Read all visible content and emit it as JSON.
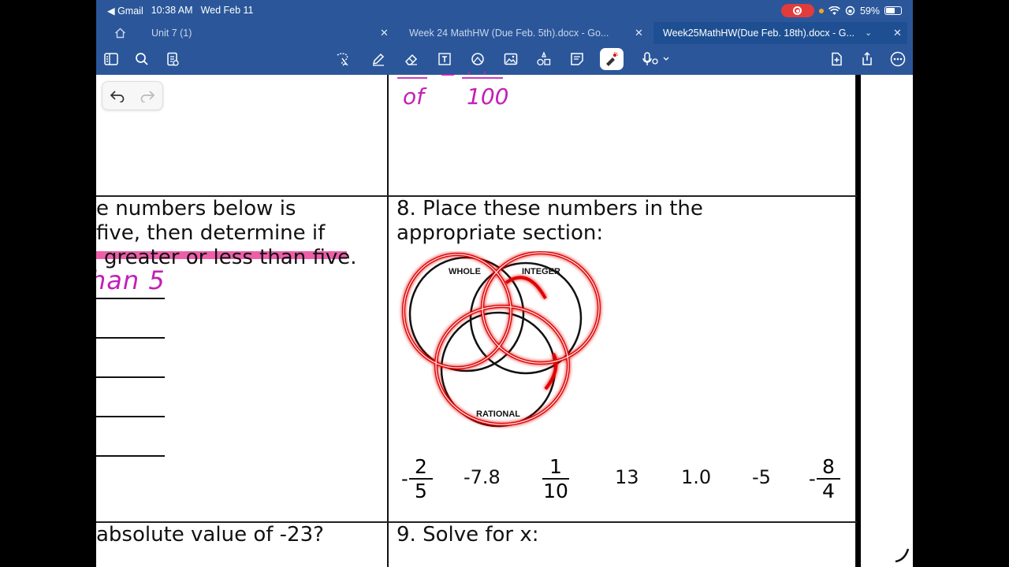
{
  "status": {
    "app_back": "◀ Gmail",
    "time": "10:38 AM",
    "date": "Wed Feb 11",
    "battery": "59%",
    "battery_level": 0.59
  },
  "tabs": [
    {
      "label": "Unit 7 (1)"
    },
    {
      "label": "Week 24 MathHW (Due Feb. 5th).docx - Go..."
    },
    {
      "label": "Week25MathHW(Due Feb. 18th).docx - G..."
    }
  ],
  "toolbar": {
    "left_icons": [
      "sidebar-icon",
      "search-icon",
      "document-view-icon"
    ],
    "center_icons": [
      "lasso-icon",
      "pen-icon",
      "eraser-icon",
      "text-box-icon",
      "shapes-icon",
      "image-icon",
      "stickers-icon",
      "sticky-note-icon",
      "laser-pointer-icon",
      "microphone-icon"
    ],
    "right_icons": [
      "add-page-icon",
      "share-icon",
      "more-icon"
    ]
  },
  "document": {
    "handwriting_top": {
      "numerator_left": "of",
      "denominator": "100"
    },
    "q7": {
      "lines": [
        "e numbers below is",
        "five, then determine if",
        "greater or less than five."
      ],
      "handwriting": "han 5"
    },
    "q8": {
      "lines": [
        "8. Place these numbers in the",
        "appropriate section:"
      ],
      "venn_labels": {
        "whole": "WHOLE",
        "integer": "INTEGER",
        "rational": "RATIONAL"
      },
      "numbers": [
        {
          "type": "fraction",
          "sign": "-",
          "num": "2",
          "den": "5"
        },
        {
          "type": "text",
          "value": "-7.8"
        },
        {
          "type": "fraction",
          "sign": "",
          "num": "1",
          "den": "10"
        },
        {
          "type": "text",
          "value": "13"
        },
        {
          "type": "text",
          "value": "1.0"
        },
        {
          "type": "text",
          "value": "-5"
        },
        {
          "type": "fraction",
          "sign": "-",
          "num": "8",
          "den": "4"
        }
      ]
    },
    "q_abs": {
      "text": "absolute value of -23?"
    },
    "q9": {
      "text": "9. Solve for x:"
    }
  },
  "colors": {
    "toolbar_blue": "#2b579a",
    "highlight_pink": "#ec5fa8",
    "ink_magenta": "#c21fb8",
    "laser_red": "#e00000"
  }
}
